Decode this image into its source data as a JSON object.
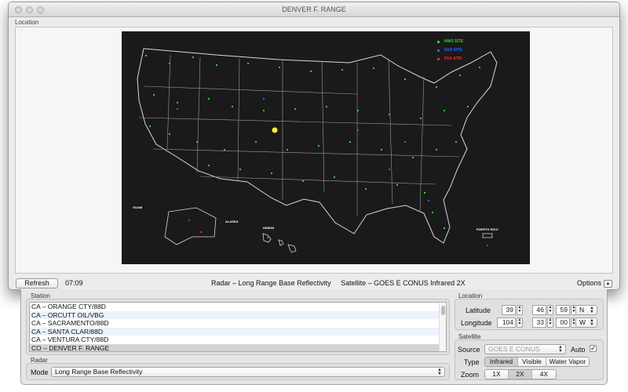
{
  "window": {
    "title": "DENVER F. RANGE"
  },
  "location_panel": {
    "label": "Location"
  },
  "map": {
    "legend": [
      {
        "label": "NWS SITE",
        "color": "#22dd22"
      },
      {
        "label": "DoD SITE",
        "color": "#3366ff"
      },
      {
        "label": "FAA SITE",
        "color": "#ff2222"
      }
    ],
    "labels": {
      "guam": "GUAM",
      "alaska": "ALASKA",
      "hawaii": "HAWAII",
      "puerto_rico": "PUERTO RICO"
    },
    "selected_marker_color": "#ffee33"
  },
  "bottombar": {
    "refresh_label": "Refresh",
    "time": "07:09",
    "status": "Radar – Long Range Base Reflectivity     Satellite – GOES E CONUS Infrared 2X",
    "options_label": "Options",
    "options_icon": "▲"
  },
  "station": {
    "label": "Station",
    "items": [
      "CA – ORANGE CTY/88D",
      "CA – ORCUTT OIL/VBG",
      "CA – SACRAMENTO/88D",
      "CA – SANTA CLAR/88D",
      "CA – VENTURA CTY/88D",
      "CO – DENVER F. RANGE"
    ]
  },
  "radar": {
    "label": "Radar",
    "mode_label": "Mode",
    "mode_value": "Long Range Base Reflectivity"
  },
  "location": {
    "label": "Location",
    "latitude_label": "Latitude",
    "latitude": {
      "deg": "39",
      "min": "46",
      "sec": "59",
      "hemi": "N"
    },
    "longitude_label": "Longitude",
    "longitude": {
      "deg": "104",
      "min": "33",
      "sec": "00",
      "hemi": "W"
    }
  },
  "satellite": {
    "label": "Satellite",
    "source_label": "Source",
    "source_value": "GOES E CONUS",
    "auto_label": "Auto",
    "auto_checked": "✓",
    "type_label": "Type",
    "types": [
      "Infrared",
      "Visible",
      "Water Vapor"
    ],
    "zoom_label": "Zoom",
    "zooms": [
      "1X",
      "2X",
      "4X"
    ]
  }
}
